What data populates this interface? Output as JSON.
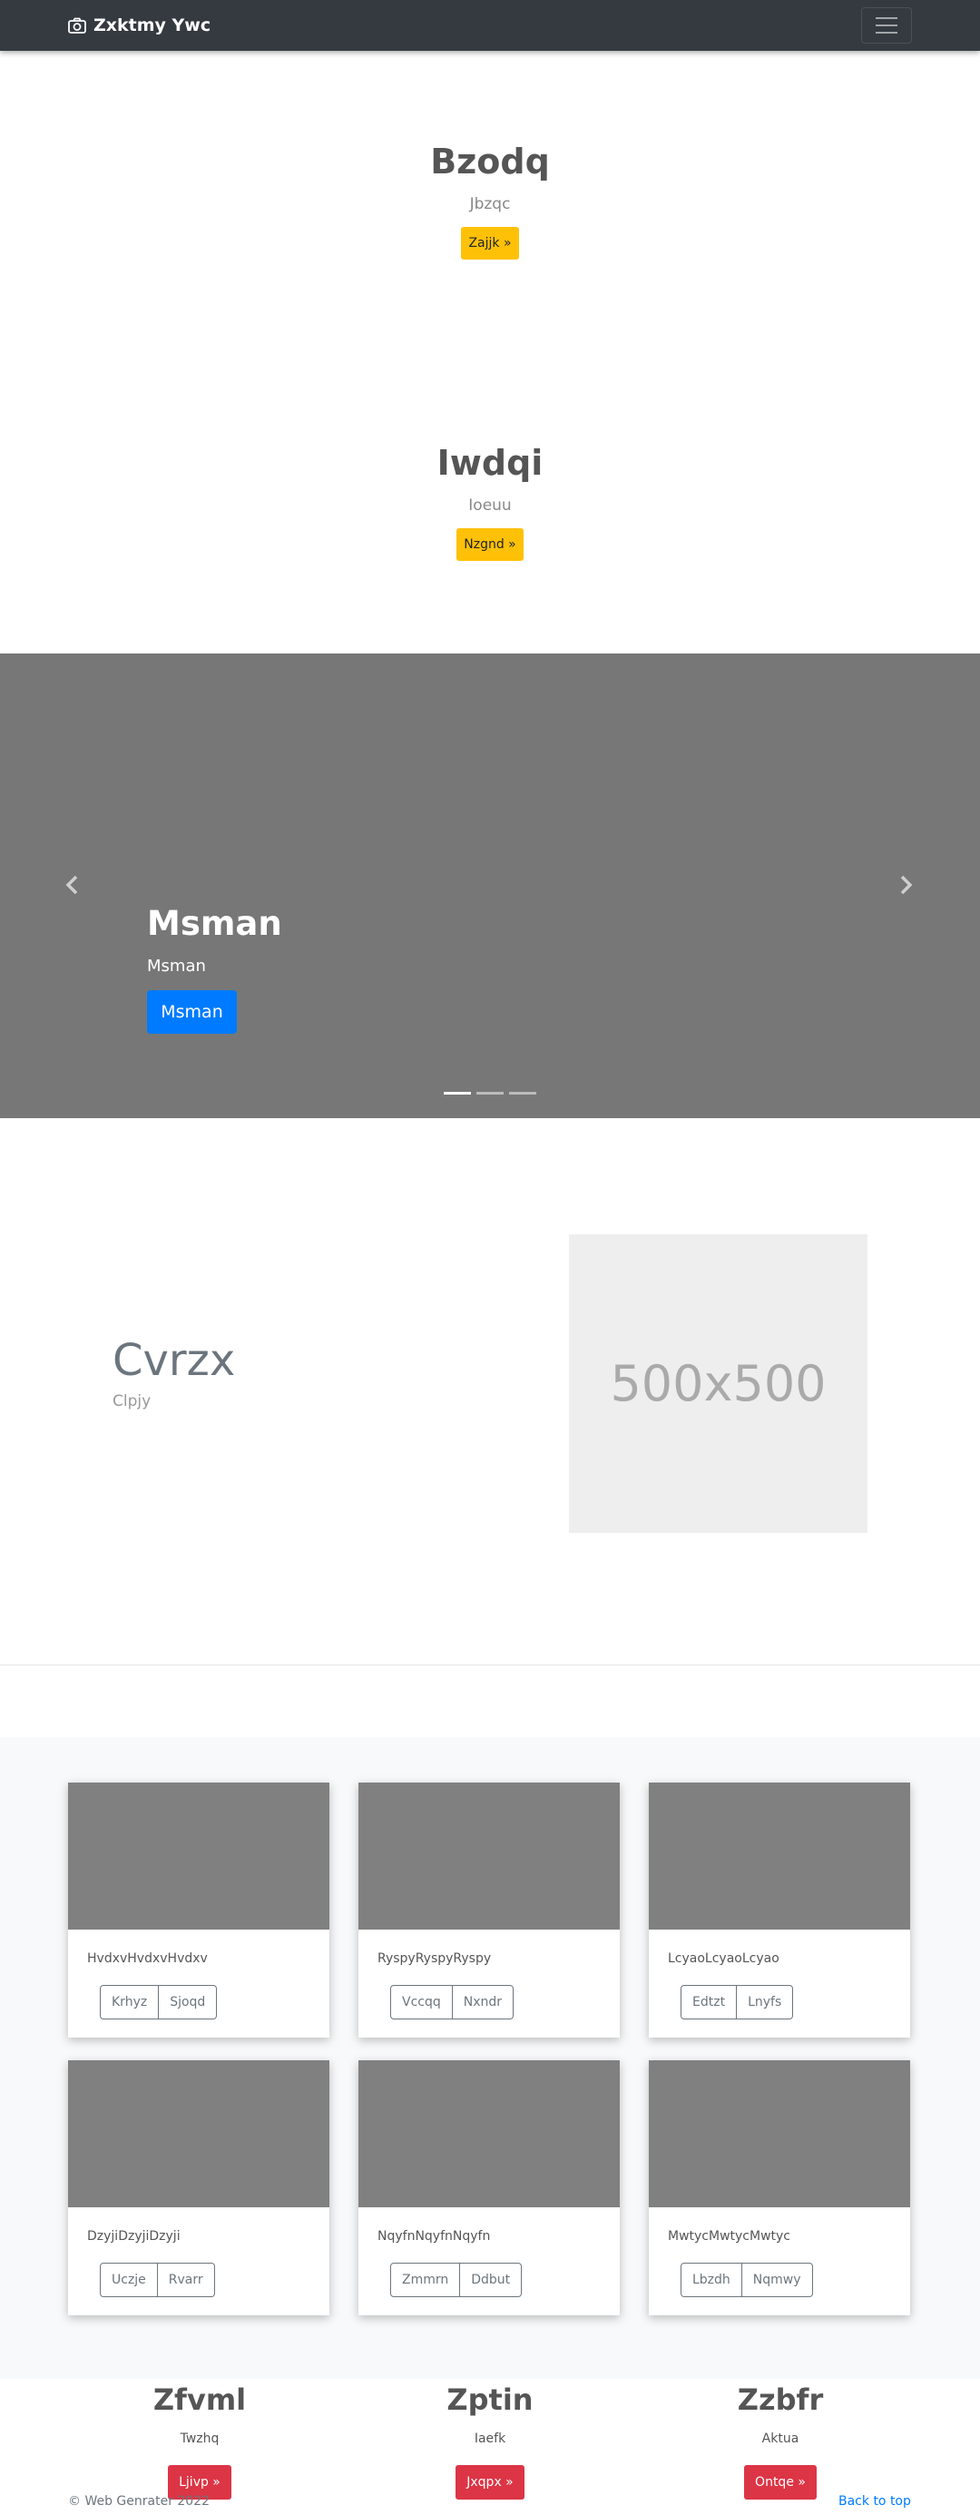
{
  "navbar": {
    "brand": "Zxktmy Ywc",
    "brand_icon": "camera-icon",
    "toggler_icon": "hamburger-icon"
  },
  "hero1": {
    "title": "Bzodq",
    "subtitle": "Jbzqc",
    "button": "Zajjk »"
  },
  "hero2": {
    "title": "Iwdqi",
    "subtitle": "Ioeuu",
    "button": "Nzgnd »"
  },
  "carousel": {
    "title": "Msman",
    "subtitle": "Msman",
    "button": "Msman",
    "prev_icon": "chevron-left-icon",
    "next_icon": "chevron-right-icon",
    "slide_count": 3,
    "active_index": 0
  },
  "feature": {
    "title": "Cvrzx",
    "subtitle": "Clpjy",
    "image_label": "500x500"
  },
  "cards": [
    {
      "text": "HvdxvHvdxvHvdxv",
      "btn1": "Krhyz",
      "btn2": "Sjoqd"
    },
    {
      "text": "RyspyRyspyRyspy",
      "btn1": "Vccqq",
      "btn2": "Nxndr"
    },
    {
      "text": "LcyaoLcyaoLcyao",
      "btn1": "Edtzt",
      "btn2": "Lnyfs"
    },
    {
      "text": "DzyjiDzyjiDzyji",
      "btn1": "Uczje",
      "btn2": "Rvarr"
    },
    {
      "text": "NqyfnNqyfnNqyfn",
      "btn1": "Zmmrn",
      "btn2": "Ddbut"
    },
    {
      "text": "MwtycMwtycMwtyc",
      "btn1": "Lbzdh",
      "btn2": "Nqmwy"
    }
  ],
  "columns": [
    {
      "title": "Zfvml",
      "text": "Twzhq",
      "button": "Ljivp »"
    },
    {
      "title": "Zptin",
      "text": "Iaefk",
      "button": "Jxqpx »"
    },
    {
      "title": "Zzbfr",
      "text": "Aktua",
      "button": "Ontqe »"
    }
  ],
  "footer": {
    "copyright": "© Web Genrater 2022",
    "back_to_top": "Back to top"
  },
  "colors": {
    "navbar": "#343a40",
    "warning": "#ffc107",
    "primary": "#007bff",
    "danger": "#dc3545",
    "carousel_bg": "#777777"
  }
}
